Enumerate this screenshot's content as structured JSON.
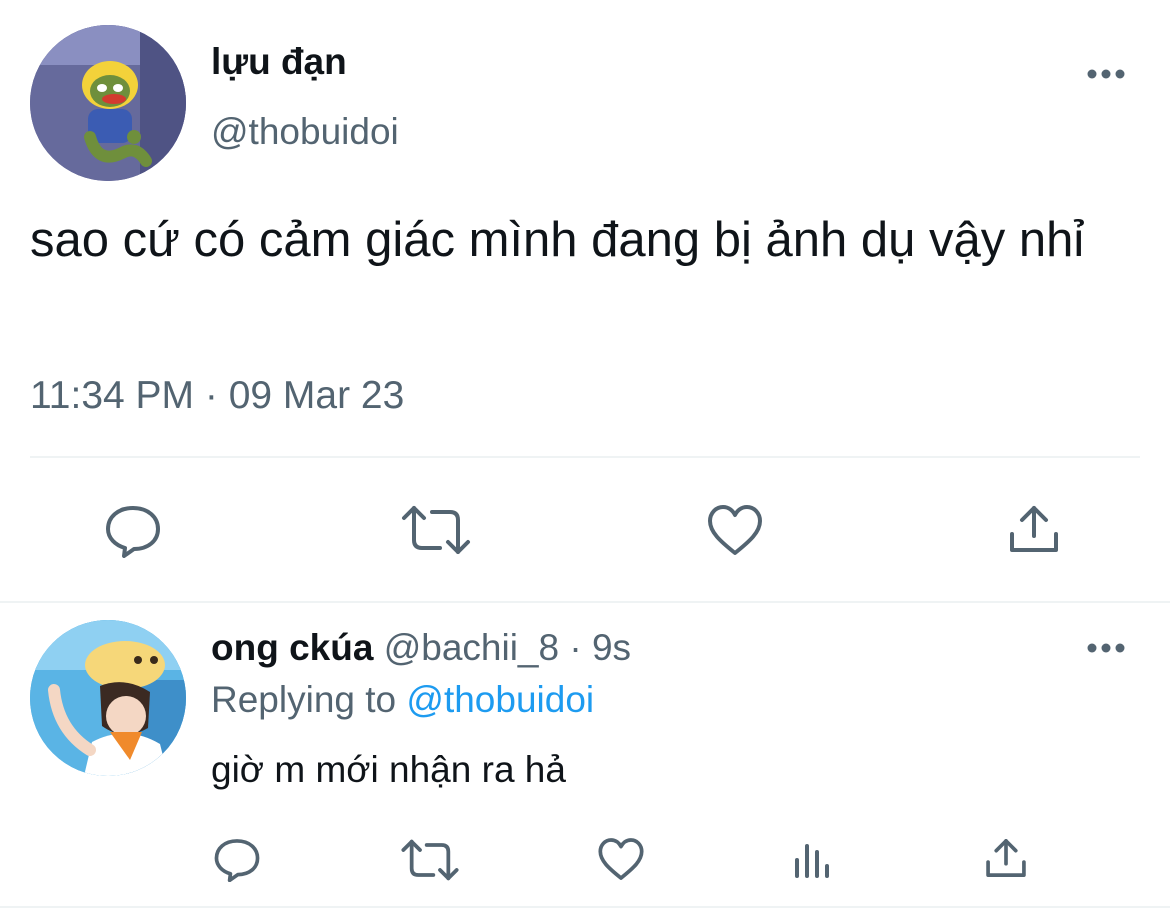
{
  "tweet": {
    "author_name": "lựu đạn",
    "author_handle": "@thobuidoi",
    "text": "sao cứ có cảm giác mình đang bị ảnh dụ vậy nhỉ",
    "timestamp": "11:34 PM · 09 Mar 23",
    "avatar_icon": "frog-plush-avatar",
    "more_icon": "more-icon"
  },
  "reply": {
    "author_name": "ong ckúa",
    "meta": "@bachii_8 · 9s",
    "replying_prefix": "Replying to",
    "replying_handle": "@thobuidoi",
    "text": "giờ m mới nhận ra hả",
    "avatar_icon": "anime-avatar",
    "more_icon": "more-icon"
  },
  "colors": {
    "text": "#0f1419",
    "muted": "#536471",
    "accent": "#1d9bf0",
    "divider": "#eff3f4"
  }
}
